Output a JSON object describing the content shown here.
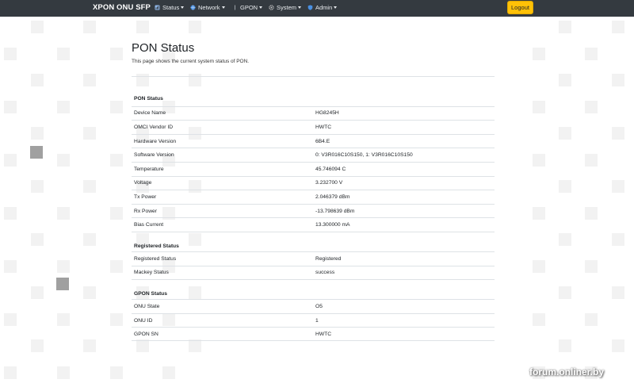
{
  "nav": {
    "brand": "XPON ONU SFP",
    "items": [
      {
        "label": "Status",
        "icon": "status-icon"
      },
      {
        "label": "Network",
        "icon": "globe-icon"
      },
      {
        "label": "GPON",
        "icon": "gpon-icon"
      },
      {
        "label": "System",
        "icon": "gear-icon"
      },
      {
        "label": "Admin",
        "icon": "shield-icon"
      }
    ],
    "logout": "Logout"
  },
  "page": {
    "title": "PON Status",
    "description": "This page shows the current system status of PON."
  },
  "sections": {
    "pon": {
      "title": "PON Status",
      "rows": [
        {
          "k": "Device Name",
          "v": "HG8245H"
        },
        {
          "k": "OMCI Vendor ID",
          "v": "HWTC"
        },
        {
          "k": "Hardware Version",
          "v": "6B4.E"
        },
        {
          "k": "Software Version",
          "v": "0: V3R016C10S150, 1: V3R016C10S150"
        },
        {
          "k": "Temperature",
          "v": "45.746094 C"
        },
        {
          "k": "Voltage",
          "v": "3.232700 V"
        },
        {
          "k": "Tx Power",
          "v": "2.046379 dBm"
        },
        {
          "k": "Rx Power",
          "v": "-13.798639 dBm"
        },
        {
          "k": "Bias Current",
          "v": "13.300000 mA"
        }
      ]
    },
    "registered": {
      "title": "Registered Status",
      "rows": [
        {
          "k": "Registered Status",
          "v": "Registered"
        },
        {
          "k": "Mackey Status",
          "v": "success"
        }
      ]
    },
    "gpon": {
      "title": "GPON Status",
      "rows": [
        {
          "k": "ONU State",
          "v": "O5"
        },
        {
          "k": "ONU ID",
          "v": "1"
        },
        {
          "k": "GPON SN",
          "v": "HWTC"
        }
      ]
    }
  },
  "watermark": "forum.onliner.by"
}
